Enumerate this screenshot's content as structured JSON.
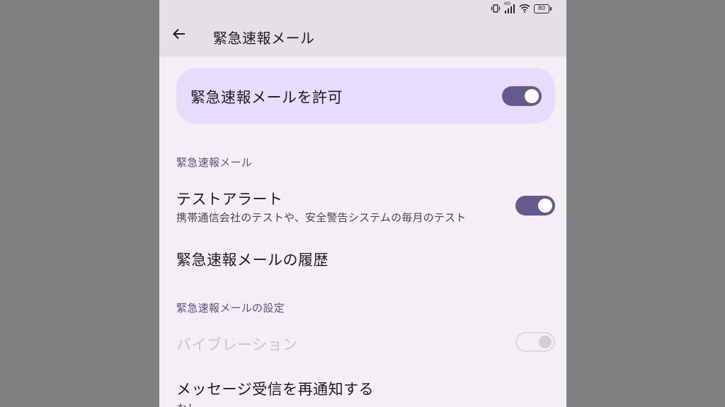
{
  "status_bar": {
    "icons": [
      "vibrate-icon",
      "signal-icon",
      "wifi-icon",
      "battery-icon"
    ],
    "network_badge": "HD",
    "battery_level": "80"
  },
  "app_bar": {
    "title": "緊急速報メール",
    "back_icon": "arrow-left-icon"
  },
  "master_toggle": {
    "label": "緊急速報メールを許可",
    "enabled": true
  },
  "sections": [
    {
      "header": "緊急速報メール",
      "items": [
        {
          "title": "テストアラート",
          "subtitle": "携帯通信会社のテストや、安全警告システムの毎月のテスト",
          "toggle": true
        },
        {
          "title": "緊急速報メールの履歴"
        }
      ]
    },
    {
      "header": "緊急速報メールの設定",
      "items": [
        {
          "title": "バイブレーション",
          "toggle": true,
          "disabled": true
        },
        {
          "title": "メッセージ受信を再通知する",
          "subtitle": "なし"
        }
      ]
    }
  ],
  "colors": {
    "background": "#f4eff6",
    "app_bar": "#e5dfe8",
    "card": "#e6dcfd",
    "accent": "#655a8e",
    "section_header": "#5c4f8a",
    "outer": "#808080"
  }
}
